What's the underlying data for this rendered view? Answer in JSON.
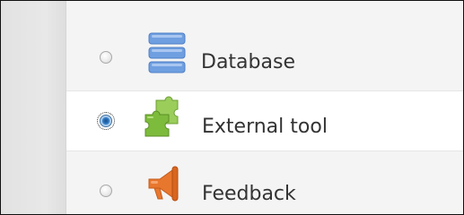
{
  "activity_chooser": {
    "options": [
      {
        "label": "Database",
        "icon": "database-icon",
        "selected": false
      },
      {
        "label": "External tool",
        "icon": "puzzle-piece-icon",
        "selected": true
      },
      {
        "label": "Feedback",
        "icon": "megaphone-icon",
        "selected": false
      }
    ]
  },
  "colors": {
    "database_icon": "#6f9fe0",
    "external_tool_icon": "#7dbb3c",
    "feedback_icon": "#e8772e",
    "radio_selected": "#2e78c4"
  }
}
